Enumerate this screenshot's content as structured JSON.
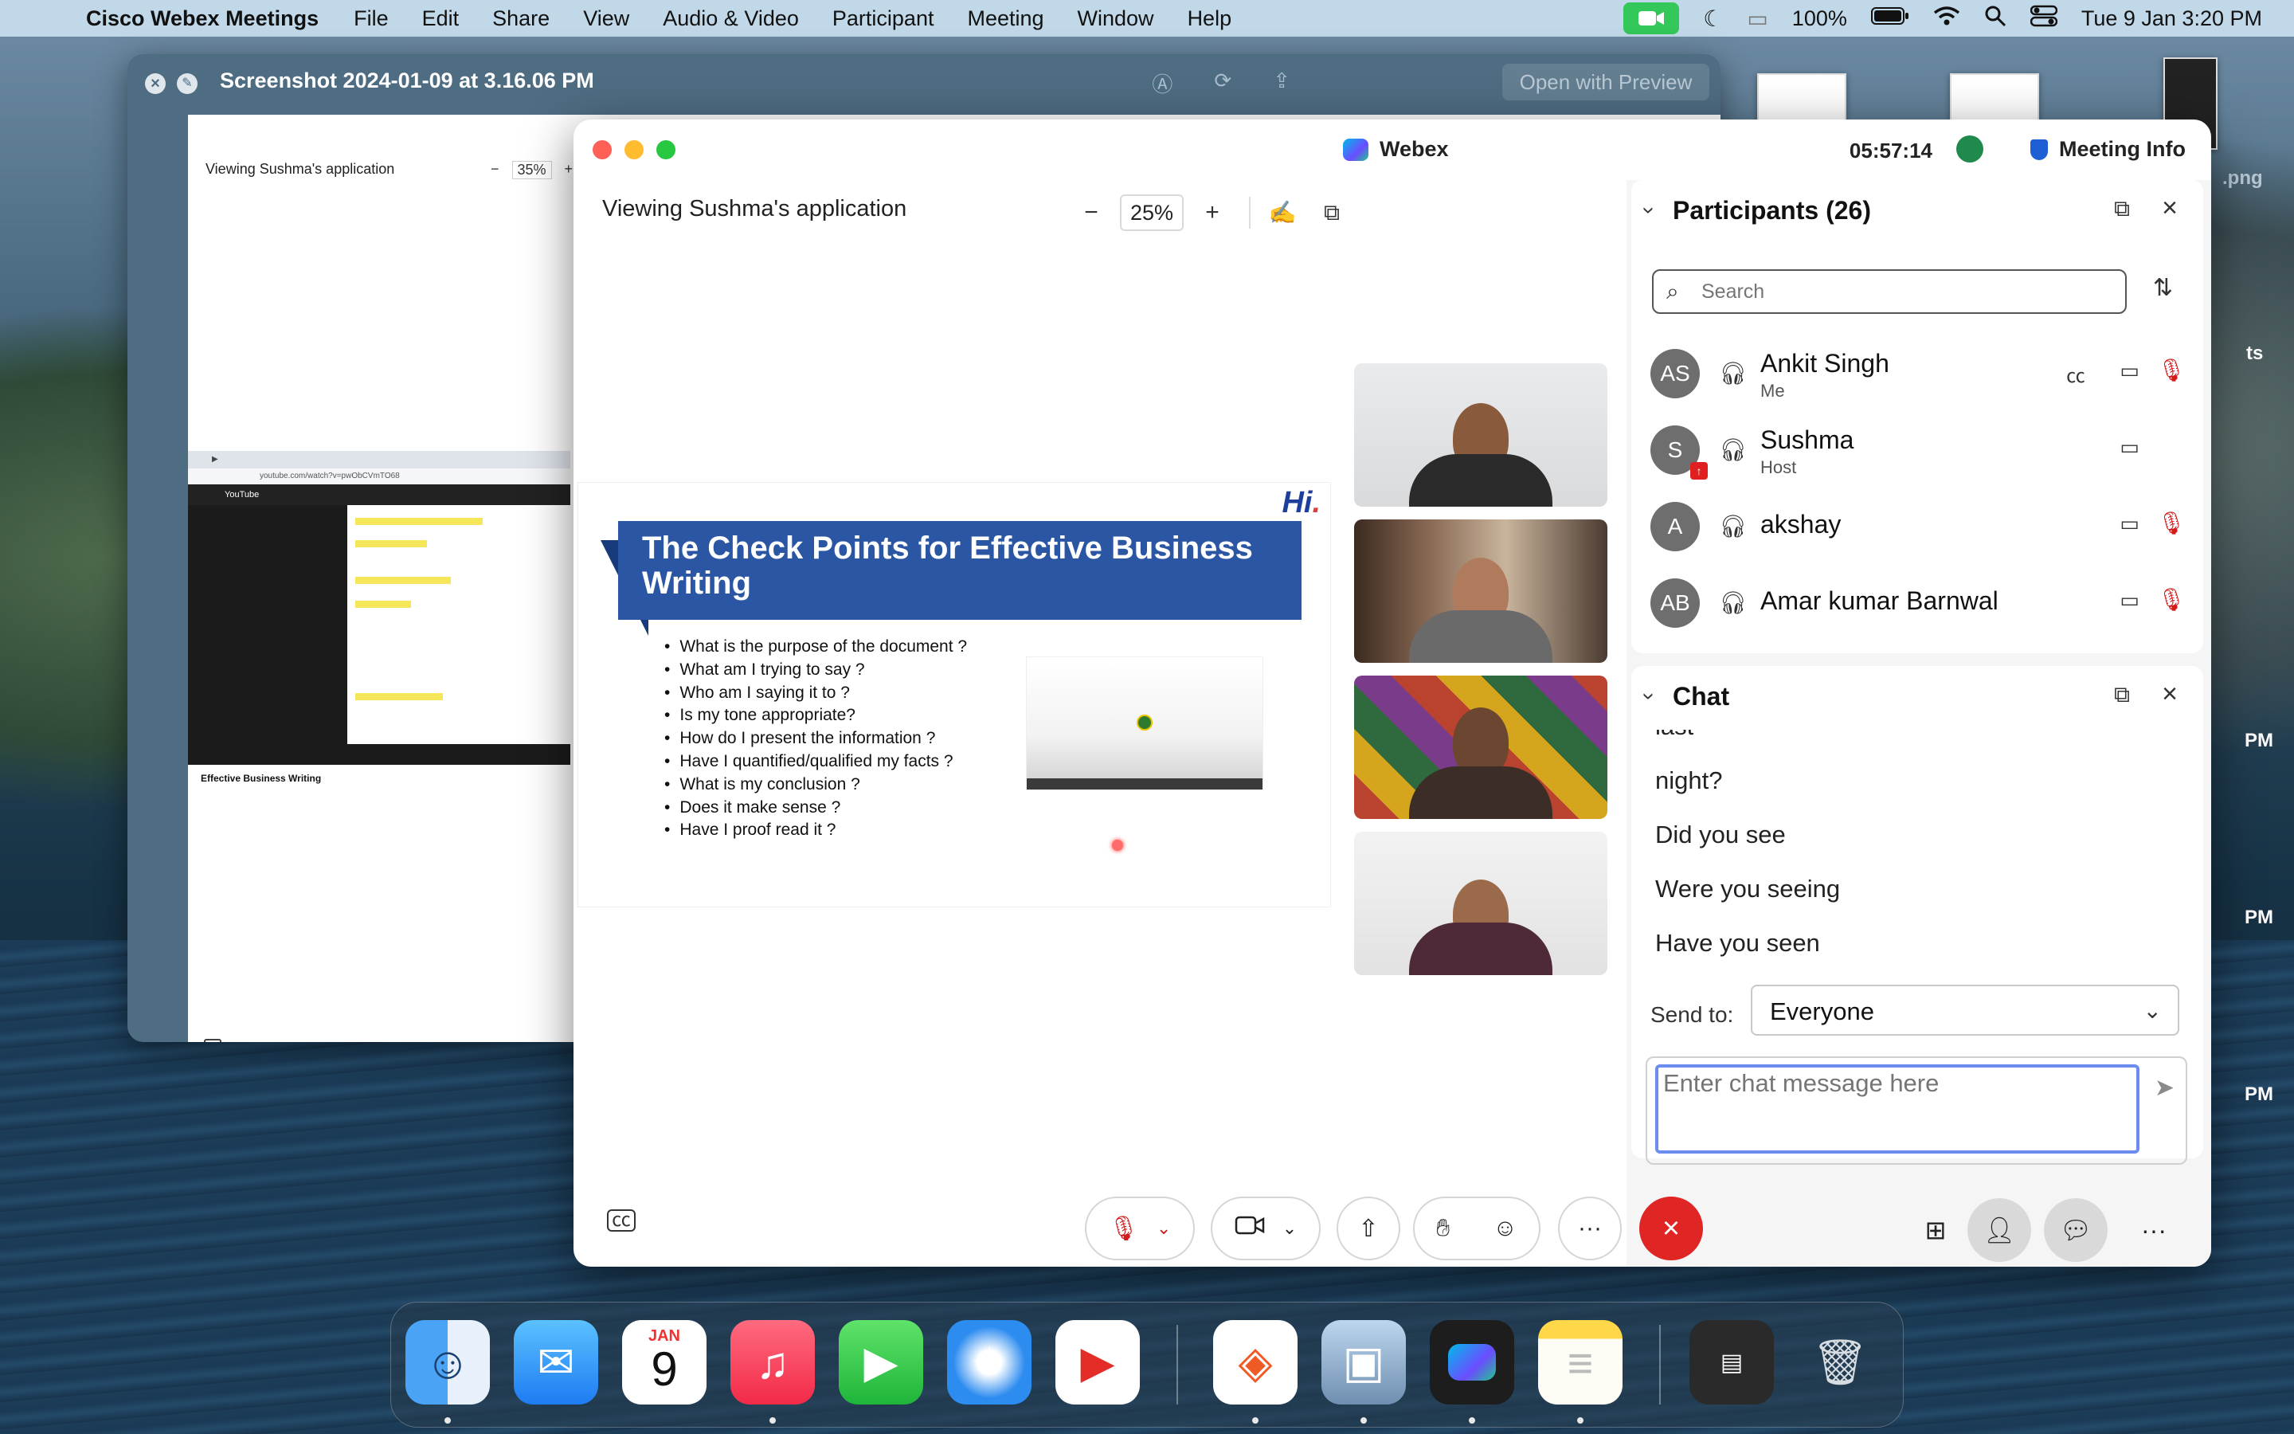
{
  "menubar": {
    "app_name": "Cisco Webex Meetings",
    "menus": [
      "File",
      "Edit",
      "Share",
      "View",
      "Audio & Video",
      "Participant",
      "Meeting",
      "Window",
      "Help"
    ],
    "battery": "100%",
    "date_time": "Tue 9 Jan  3:20 PM"
  },
  "preview_window": {
    "title": "Screenshot 2024-01-09 at 3.16.06 PM",
    "open_button": "Open with Preview",
    "inner_label": "Viewing Sushma's application",
    "inner_zoom": "35%",
    "video_title": "Effective Business Writing",
    "youtube_label": "YouTube",
    "url": "youtube.com/watch?v=pwObCVmTO68"
  },
  "webex": {
    "brand": "Webex",
    "timer": "05:57:14",
    "meeting_info": "Meeting Info",
    "share_label": "Viewing Sushma's application",
    "zoom_value": "25%",
    "slide": {
      "title": "The Check Points for Effective Business Writing",
      "logo": "Hi",
      "bullets": [
        "What is the purpose of the document ?",
        "What am I trying to say ?",
        "Who am I saying it to ?",
        "Is my tone appropriate?",
        "How do I present the information ?",
        "Have I quantified/qualified my facts ?",
        "What is my conclusion ?",
        "Does it make sense ?",
        "Have I proof read it ?"
      ]
    },
    "participants": {
      "title": "Participants (26)",
      "search_placeholder": "Search",
      "list": [
        {
          "initials": "AS",
          "name": "Ankit Singh",
          "role": "Me"
        },
        {
          "initials": "S",
          "name": "Sushma",
          "role": "Host"
        },
        {
          "initials": "A",
          "name": "akshay",
          "role": ""
        },
        {
          "initials": "AB",
          "name": "Amar kumar Barnwal",
          "role": ""
        }
      ]
    },
    "chat": {
      "title": "Chat",
      "messages": [
        "last",
        "night?",
        "Did you see",
        "Were you seeing",
        "Have you seen"
      ],
      "send_to_label": "Send to:",
      "send_to_value": "Everyone",
      "input_placeholder": "Enter chat message here"
    }
  },
  "dock": {
    "calendar_month": "JAN",
    "calendar_day": "9"
  },
  "colors": {
    "webex_blue": "#2b56a3",
    "leave_red": "#e02525",
    "mute_red": "#d11d1d",
    "facetime_green": "#34c759"
  }
}
